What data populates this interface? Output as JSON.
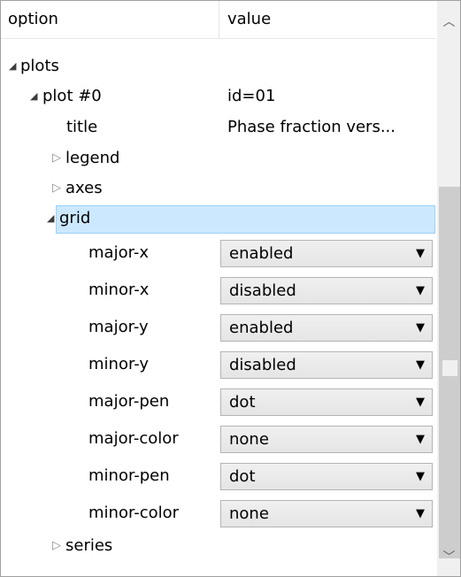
{
  "header": {
    "option_label": "option",
    "value_label": "value"
  },
  "tree": {
    "plots_label": "plots",
    "plot_label": "plot #0",
    "plot_value": "id=01",
    "title_label": "title",
    "title_value": "Phase fraction vers...",
    "legend_label": "legend",
    "axes_label": "axes",
    "grid_label": "grid",
    "series_label": "series"
  },
  "grid_settings": [
    {
      "label": "major-x",
      "value": "enabled"
    },
    {
      "label": "minor-x",
      "value": "disabled"
    },
    {
      "label": "major-y",
      "value": "enabled"
    },
    {
      "label": "minor-y",
      "value": "disabled"
    },
    {
      "label": "major-pen",
      "value": "dot"
    },
    {
      "label": "major-color",
      "value": "none"
    },
    {
      "label": "minor-pen",
      "value": "dot"
    },
    {
      "label": "minor-color",
      "value": "none"
    }
  ],
  "icons": {
    "expanded": "triangle-expanded-icon",
    "collapsed": "triangle-collapsed-icon",
    "dropdown": "dropdown-arrow-icon",
    "scroll_up": "scroll-up-icon",
    "scroll_down": "scroll-down-icon"
  },
  "colors": {
    "selection_bg": "#cce8ff",
    "selection_border": "#99d1ff",
    "scrollbar_thumb": "#cdcdcd"
  }
}
